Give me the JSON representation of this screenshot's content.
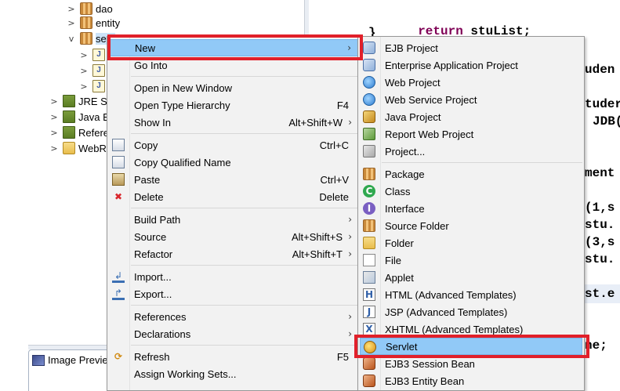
{
  "explorer": {
    "rows": [
      {
        "label": "dao",
        "twisty": ">",
        "icon": "package-icon"
      },
      {
        "label": "entity",
        "twisty": ">",
        "icon": "package-icon"
      },
      {
        "label": "serv",
        "twisty": "v",
        "icon": "package-icon",
        "selected": true
      },
      {
        "label": "",
        "twisty": ">",
        "icon": "java-file-icon"
      },
      {
        "label": "",
        "twisty": ">",
        "icon": "java-file-icon"
      },
      {
        "label": "",
        "twisty": ">",
        "icon": "java-file-icon"
      },
      {
        "label": "JRE Sy",
        "twisty": ">",
        "icon": "library-icon"
      },
      {
        "label": "Java E",
        "twisty": ">",
        "icon": "library-icon"
      },
      {
        "label": "Refere",
        "twisty": ">",
        "icon": "library-icon"
      },
      {
        "label": "WebR",
        "twisty": ">",
        "icon": "folder-icon"
      }
    ],
    "preview_tab_label": "Image Previe"
  },
  "editor": {
    "lines": [
      {
        "text": "return stuList;",
        "kw": "return"
      },
      {
        "text": "}",
        "kw": ""
      },
      {
        "text": "uden",
        "kw": ""
      },
      {
        "text": "tuder",
        "kw": ""
      },
      {
        "text": "JDB(",
        "kw": ""
      },
      {
        "text": "ment",
        "kw": ""
      },
      {
        "text": "(1,s",
        "kw": ""
      },
      {
        "text": "stu.",
        "kw": ""
      },
      {
        "text": "(3,s",
        "kw": ""
      },
      {
        "text": "stu.",
        "kw": ""
      },
      {
        "text": "st.e",
        "kw": ""
      },
      {
        "text": "ne;",
        "kw": ""
      }
    ]
  },
  "context_menu": {
    "items": [
      {
        "label": "New",
        "shortcut": "",
        "submenu": true,
        "icon": "",
        "hover": true
      },
      {
        "label": "Go Into",
        "shortcut": "",
        "submenu": false,
        "icon": ""
      },
      {
        "sep": true
      },
      {
        "label": "Open in New Window",
        "shortcut": "",
        "submenu": false,
        "icon": ""
      },
      {
        "label": "Open Type Hierarchy",
        "shortcut": "F4",
        "submenu": false,
        "icon": ""
      },
      {
        "label": "Show In",
        "shortcut": "Alt+Shift+W",
        "submenu": true,
        "icon": ""
      },
      {
        "sep": true
      },
      {
        "label": "Copy",
        "shortcut": "Ctrl+C",
        "submenu": false,
        "icon": "copy-icon"
      },
      {
        "label": "Copy Qualified Name",
        "shortcut": "",
        "submenu": false,
        "icon": "copy-icon"
      },
      {
        "label": "Paste",
        "shortcut": "Ctrl+V",
        "submenu": false,
        "icon": "paste-icon"
      },
      {
        "label": "Delete",
        "shortcut": "Delete",
        "submenu": false,
        "icon": "delete-icon"
      },
      {
        "sep": true
      },
      {
        "label": "Build Path",
        "shortcut": "",
        "submenu": true,
        "icon": ""
      },
      {
        "label": "Source",
        "shortcut": "Alt+Shift+S",
        "submenu": true,
        "icon": ""
      },
      {
        "label": "Refactor",
        "shortcut": "Alt+Shift+T",
        "submenu": true,
        "icon": ""
      },
      {
        "sep": true
      },
      {
        "label": "Import...",
        "shortcut": "",
        "submenu": false,
        "icon": "import-icon"
      },
      {
        "label": "Export...",
        "shortcut": "",
        "submenu": false,
        "icon": "export-icon"
      },
      {
        "sep": true
      },
      {
        "label": "References",
        "shortcut": "",
        "submenu": true,
        "icon": ""
      },
      {
        "label": "Declarations",
        "shortcut": "",
        "submenu": true,
        "icon": ""
      },
      {
        "sep": true
      },
      {
        "label": "Refresh",
        "shortcut": "F5",
        "submenu": false,
        "icon": "refresh-icon"
      },
      {
        "label": "Assign Working Sets...",
        "shortcut": "",
        "submenu": false,
        "icon": ""
      }
    ]
  },
  "new_submenu": {
    "items": [
      {
        "label": "EJB Project",
        "icon": "ejb-project-icon",
        "glyph": ""
      },
      {
        "label": "Enterprise Application Project",
        "icon": "enterprise-project-icon",
        "glyph": ""
      },
      {
        "label": "Web Project",
        "icon": "web-project-icon",
        "glyph": ""
      },
      {
        "label": "Web Service Project",
        "icon": "web-service-project-icon",
        "glyph": ""
      },
      {
        "label": "Java Project",
        "icon": "java-project-icon",
        "glyph": ""
      },
      {
        "label": "Report Web Project",
        "icon": "report-project-icon",
        "glyph": ""
      },
      {
        "label": "Project...",
        "icon": "project-icon",
        "glyph": ""
      },
      {
        "sep": true
      },
      {
        "label": "Package",
        "icon": "package-icon",
        "glyph": ""
      },
      {
        "label": "Class",
        "icon": "class-icon",
        "glyph": "C"
      },
      {
        "label": "Interface",
        "icon": "interface-icon",
        "glyph": "I"
      },
      {
        "label": "Source Folder",
        "icon": "source-folder-icon",
        "glyph": ""
      },
      {
        "label": "Folder",
        "icon": "folder-icon",
        "glyph": ""
      },
      {
        "label": "File",
        "icon": "file-icon",
        "glyph": ""
      },
      {
        "label": "Applet",
        "icon": "applet-icon",
        "glyph": ""
      },
      {
        "label": "HTML (Advanced Templates)",
        "icon": "html-file-icon",
        "glyph": "H"
      },
      {
        "label": "JSP (Advanced Templates)",
        "icon": "jsp-file-icon",
        "glyph": "J"
      },
      {
        "label": "XHTML (Advanced Templates)",
        "icon": "xhtml-file-icon",
        "glyph": "X"
      },
      {
        "label": "Servlet",
        "icon": "servlet-icon",
        "glyph": "",
        "hover": true
      },
      {
        "label": "EJB3 Session Bean",
        "icon": "session-bean-icon",
        "glyph": ""
      },
      {
        "label": "EJB3 Entity Bean",
        "icon": "entity-bean-icon",
        "glyph": ""
      }
    ]
  },
  "colors": {
    "menu_bg": "#f2f2f2",
    "hover_bg": "#91c9f7",
    "annotation_red": "#e1202a",
    "keyword": "#7f0055"
  },
  "glyphs": {
    "submenu_arrow": "›",
    "delete": "✖",
    "refresh": "⟳",
    "import": "↲",
    "export": "↱"
  }
}
